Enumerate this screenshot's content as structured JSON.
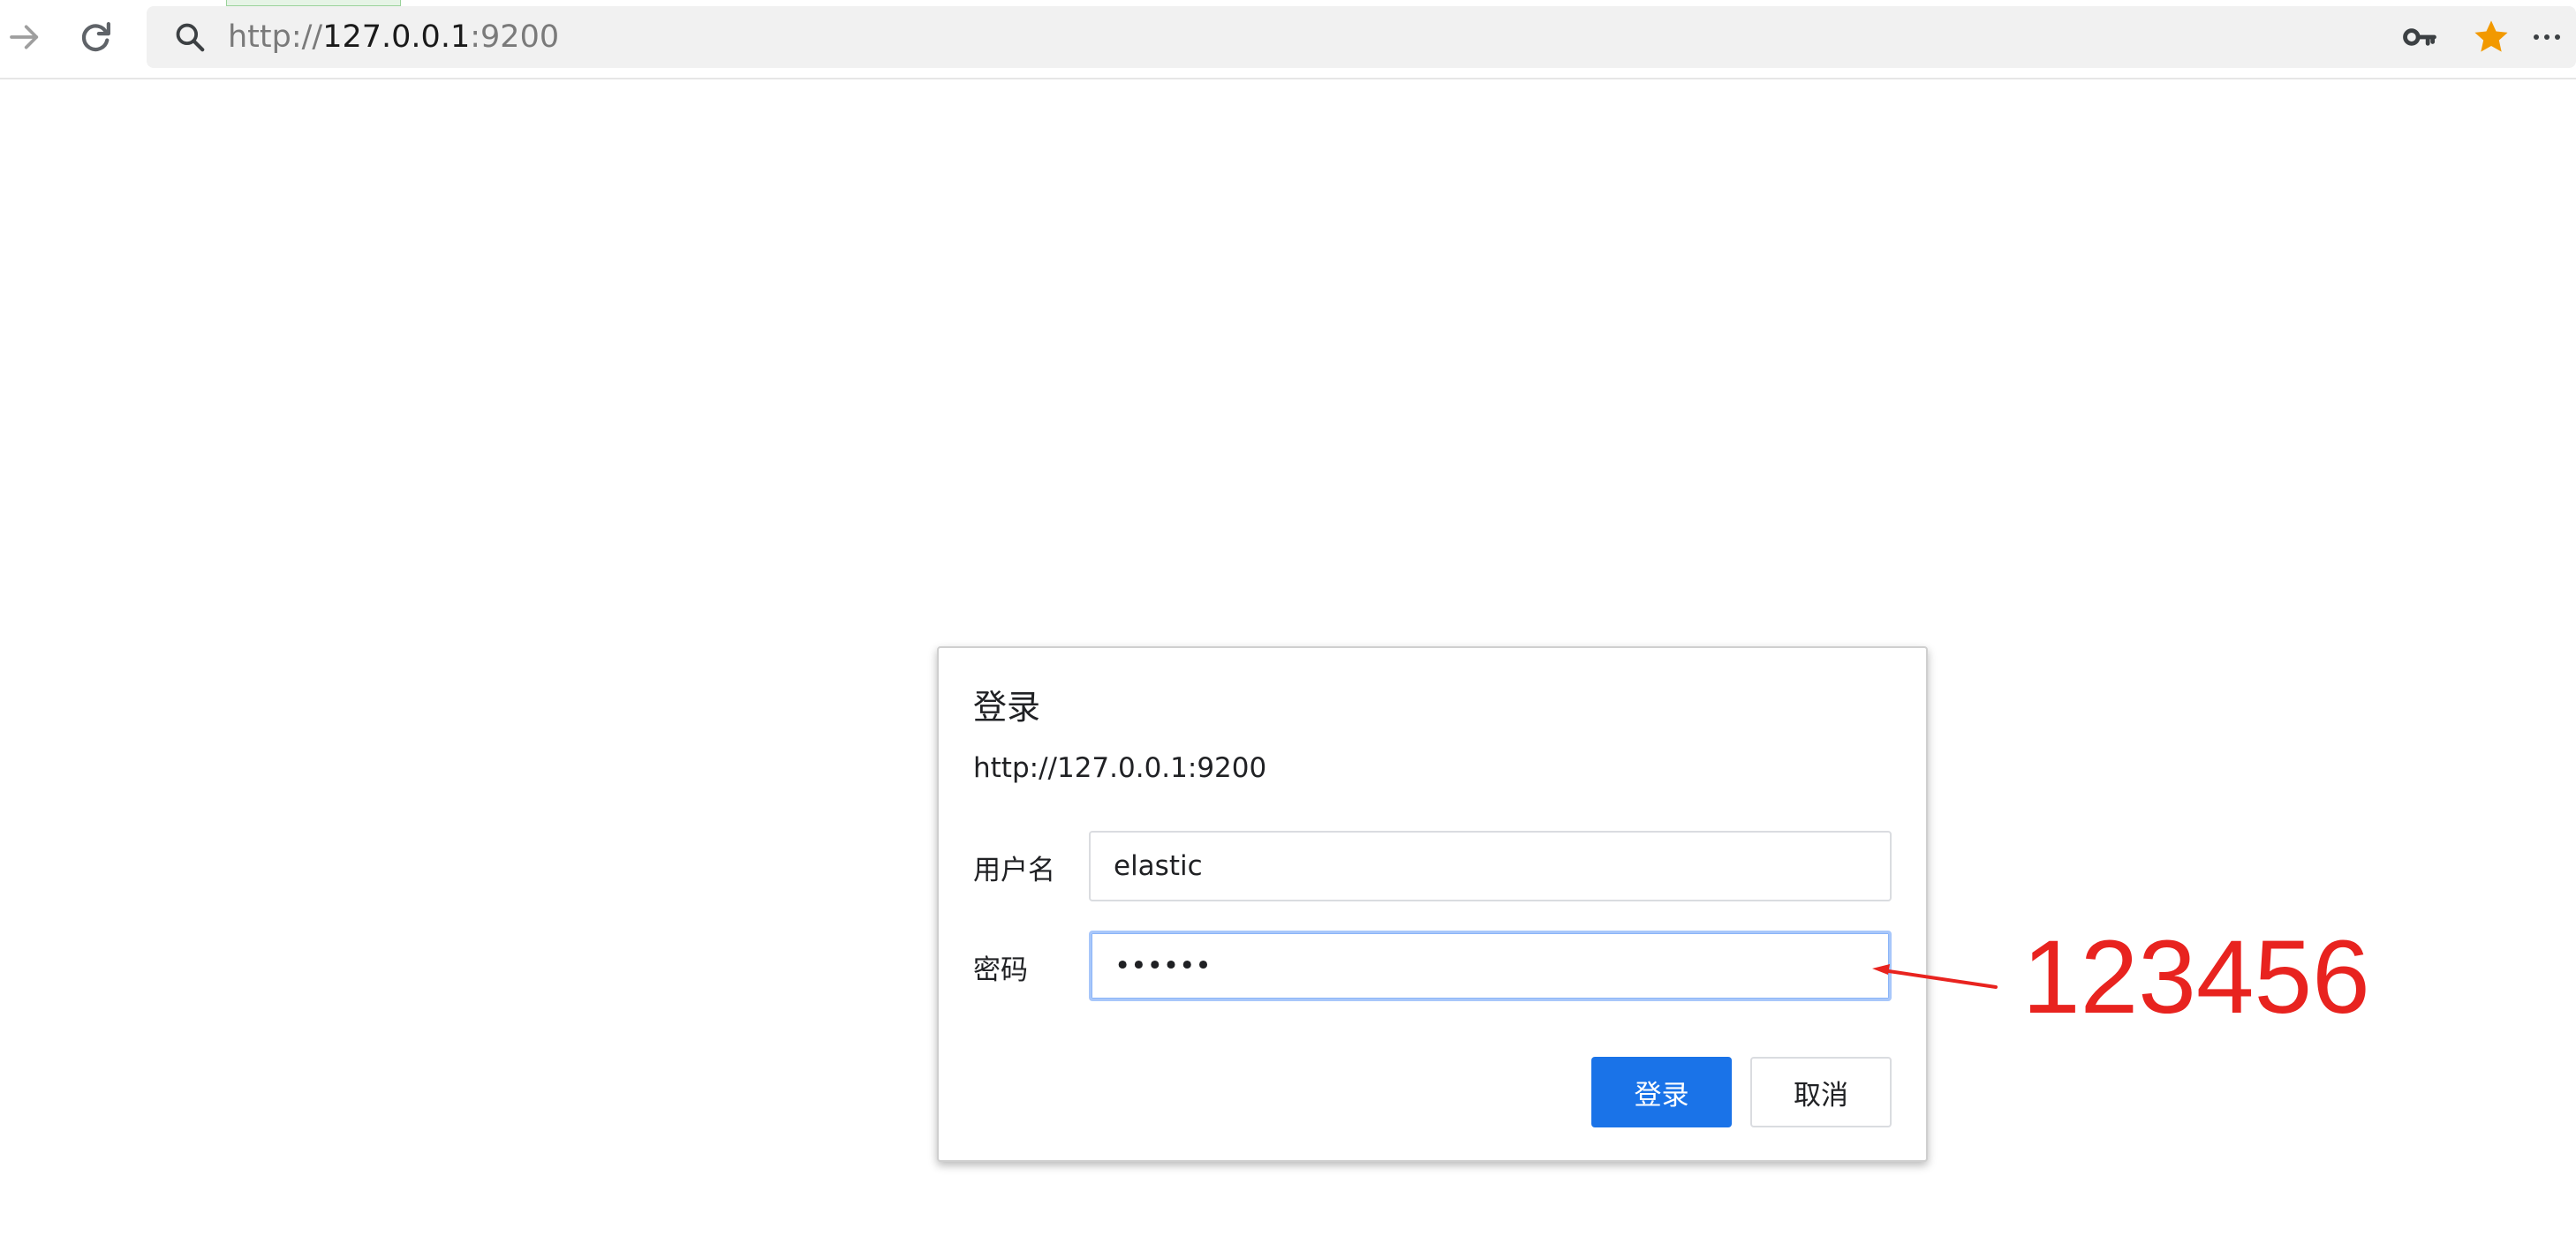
{
  "browser": {
    "url_prefix": "http://",
    "url_host": "127.0.0.1",
    "url_port": ":9200",
    "icons": {
      "forward": "arrow-right-icon",
      "reload": "reload-icon",
      "search": "search-icon",
      "key": "key-icon",
      "bookmark": "star-icon",
      "menu": "more-icon"
    },
    "star_color": "#f29900"
  },
  "dialog": {
    "title": "登录",
    "origin": "http://127.0.0.1:9200",
    "username_label": "用户名",
    "username_value": "elastic",
    "password_label": "密码",
    "password_value": "123456",
    "submit_label": "登录",
    "cancel_label": "取消",
    "accent_color": "#1a73e8"
  },
  "annotation": {
    "text": "123456",
    "color": "#e8231f"
  }
}
